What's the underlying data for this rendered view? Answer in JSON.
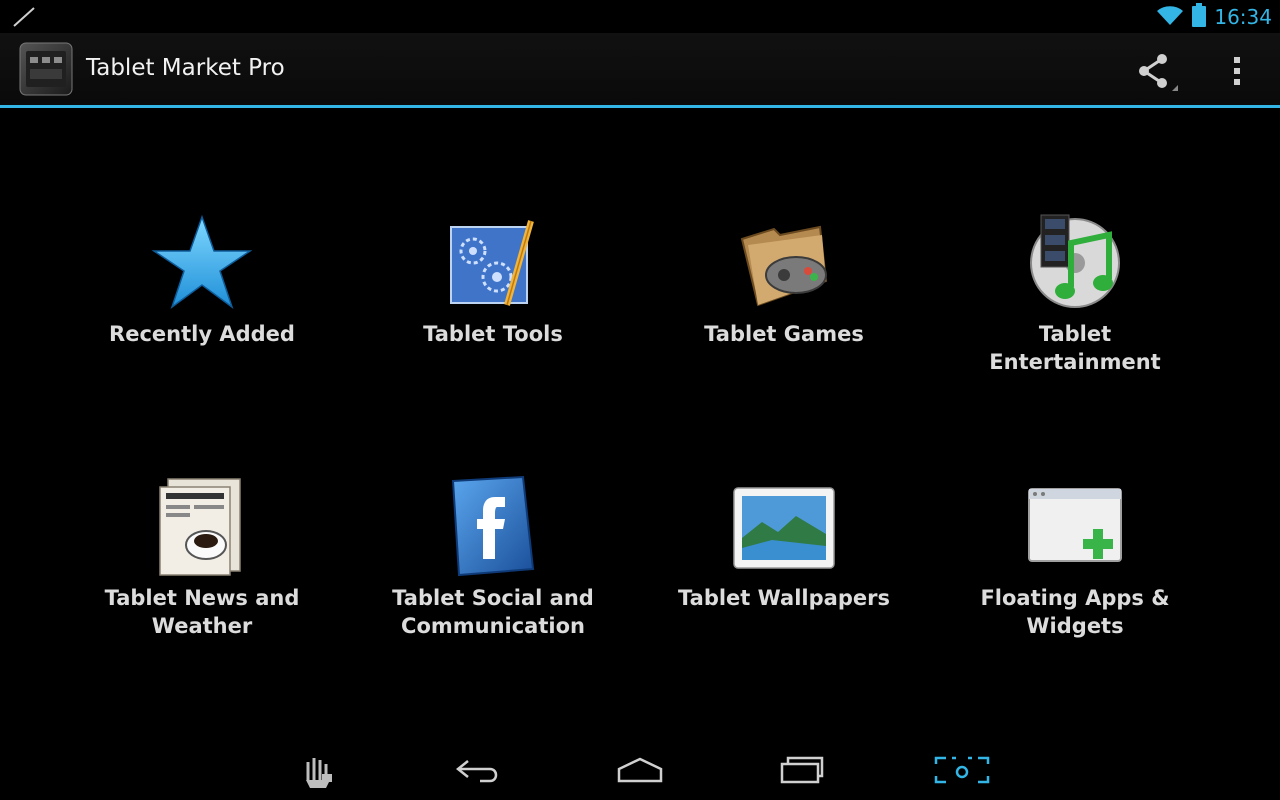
{
  "status_bar": {
    "time": "16:34",
    "left_icon": "pen-icon",
    "wifi_icon": "wifi-icon",
    "battery_icon": "battery-icon"
  },
  "action_bar": {
    "title": "Tablet Market Pro",
    "app_icon": "tablet-app-icon",
    "share_icon": "share-icon",
    "overflow_icon": "overflow-menu-icon"
  },
  "categories": [
    {
      "label": "Recently Added",
      "icon": "star-icon"
    },
    {
      "label": "Tablet Tools",
      "icon": "blueprint-tools-icon"
    },
    {
      "label": "Tablet Games",
      "icon": "gamepad-folder-icon"
    },
    {
      "label": "Tablet\nEntertainment",
      "icon": "media-music-icon"
    },
    {
      "label": "Tablet News and\nWeather",
      "icon": "newspaper-icon"
    },
    {
      "label": "Tablet Social and\nCommunication",
      "icon": "facebook-icon"
    },
    {
      "label": "Tablet Wallpapers",
      "icon": "landscape-picture-icon"
    },
    {
      "label": "Floating Apps &\nWidgets",
      "icon": "window-plus-icon"
    }
  ],
  "nav_bar": {
    "items": [
      "gesture-lock-icon",
      "back-icon",
      "home-icon",
      "recents-icon",
      "screenshot-icon"
    ]
  },
  "colors": {
    "accent": "#33b5e5",
    "background": "#000000"
  }
}
